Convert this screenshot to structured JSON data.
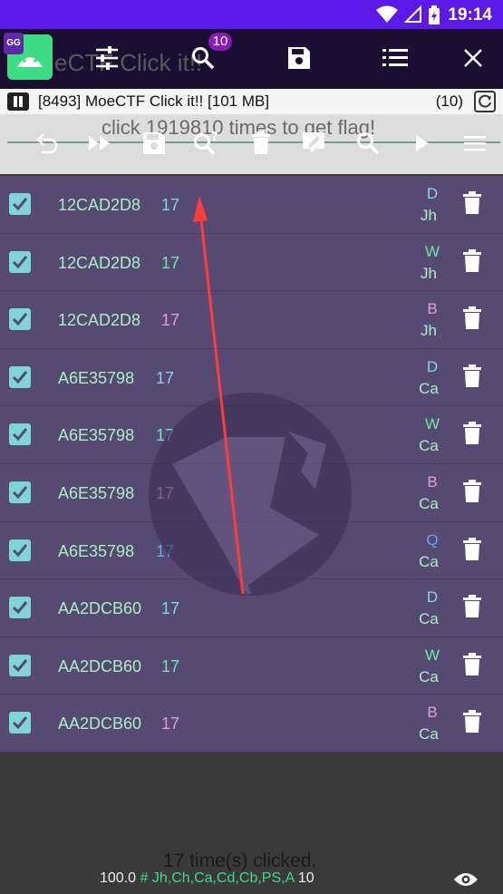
{
  "status_bar": {
    "time": "19:14"
  },
  "header": {
    "app_badge": "GG",
    "title_behind": "eCTF Click it!!",
    "search_badge": "10"
  },
  "process": {
    "label": "[8493] MoeCTF Click it!! [101 MB]",
    "count": "(10)"
  },
  "toolbar": {
    "background_text": "click 1919810 times to get flag!"
  },
  "results": [
    {
      "address": "12CAD2D8",
      "value": "17",
      "value_color": "#7fd5f0",
      "type_code": "D",
      "type_code_color": "#7fd5f0",
      "region": "Jh"
    },
    {
      "address": "12CAD2D8",
      "value": "17",
      "value_color": "#6ee8a8",
      "type_code": "W",
      "type_code_color": "#6ee8a8",
      "region": "Jh"
    },
    {
      "address": "12CAD2D8",
      "value": "17",
      "value_color": "#e59ae8",
      "type_code": "B",
      "type_code_color": "#e59ae8",
      "region": "Jh"
    },
    {
      "address": "A6E35798",
      "value": "17",
      "value_color": "#7fd5f0",
      "type_code": "D",
      "type_code_color": "#7fd5f0",
      "region": "Ca"
    },
    {
      "address": "A6E35798",
      "value": "17",
      "value_color": "#6ee8a8",
      "type_code": "W",
      "type_code_color": "#6ee8a8",
      "region": "Ca"
    },
    {
      "address": "A6E35798",
      "value": "17",
      "value_color": "#e59ae8",
      "type_code": "B",
      "type_code_color": "#e59ae8",
      "region": "Ca"
    },
    {
      "address": "A6E35798",
      "value": "17",
      "value_color": "#5aaaf0",
      "type_code": "Q",
      "type_code_color": "#5aaaf0",
      "region": "Ca"
    },
    {
      "address": "AA2DCB60",
      "value": "17",
      "value_color": "#7fd5f0",
      "type_code": "D",
      "type_code_color": "#7fd5f0",
      "region": "Ca"
    },
    {
      "address": "AA2DCB60",
      "value": "17",
      "value_color": "#6ee8a8",
      "type_code": "W",
      "type_code_color": "#6ee8a8",
      "region": "Ca"
    },
    {
      "address": "AA2DCB60",
      "value": "17",
      "value_color": "#e59ae8",
      "type_code": "B",
      "type_code_color": "#e59ae8",
      "region": "Ca"
    }
  ],
  "footer": {
    "clicked_text": "17 time(s) clicked.",
    "speed": "100.0",
    "hash": "#",
    "regions": "Jh,Ch,Ca,Cd,Cb,PS,A",
    "found_count": "10"
  },
  "colors": {
    "status_bar": "#5c1ae8",
    "header": "#1a0f33",
    "list_bg": "#574a72",
    "checkbox": "#7fd5d6",
    "address": "#a8efc4",
    "arrow": "#ff3b3b"
  }
}
